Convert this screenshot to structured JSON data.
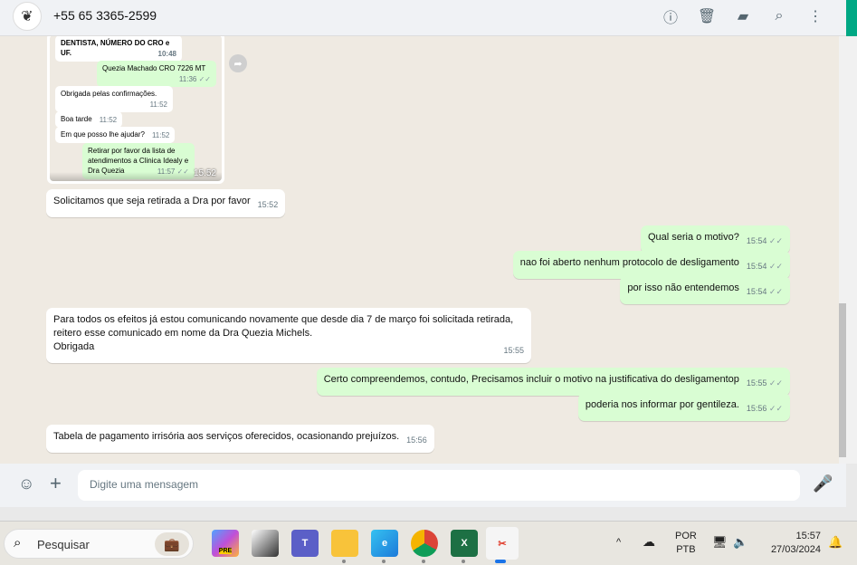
{
  "header": {
    "phone": "+55 65 3365-2599",
    "icons": [
      "info-icon",
      "trash-icon",
      "label-icon",
      "search-icon",
      "menu-icon"
    ]
  },
  "image": {
    "time": "15:52",
    "messages": [
      {
        "text": "DENTISTA, NÚMERO DO CRO e UF.",
        "time": "10:48",
        "dir": "in"
      },
      {
        "text": "Quezia Machado CRO 7226 MT",
        "time": "11:36",
        "dir": "out"
      },
      {
        "text": "Obrigada pelas confirmações.",
        "time": "11:52",
        "dir": "in"
      },
      {
        "text": "Boa tarde",
        "time": "11:52",
        "dir": "in"
      },
      {
        "text": "Em que posso lhe ajudar?",
        "time": "11:52",
        "dir": "in"
      },
      {
        "text": "Retirar por favor da lista de atendimentos a Clinica Idealy e Dra Quezia",
        "time": "11:57",
        "dir": "out"
      }
    ]
  },
  "messages": [
    {
      "text": "Solicitamos que seja retirada a Dra por favor",
      "time": "15:52"
    },
    {
      "text": "Qual seria o motivo?",
      "time": "15:54"
    },
    {
      "text": "nao foi aberto nenhum protocolo de desligamento",
      "time": "15:54"
    },
    {
      "text": "por isso não entendemos",
      "time": "15:54"
    },
    {
      "line1": "Para todos os efeitos já estou comunicando novamente que desde dia 7 de março foi solicitada retirada,",
      "line2": "reitero esse comunicado em nome da Dra Quezia Michels.",
      "line3": "Obrigada",
      "time": "15:55"
    },
    {
      "text": "Certo compreendemos, contudo, Precisamos incluir o motivo na justificativa do desligamentop",
      "time": "15:55"
    },
    {
      "text": "poderia nos informar por gentileza.",
      "time": "15:56"
    },
    {
      "text": "Tabela de pagamento irrisória aos serviços oferecidos, ocasionando prejuízos.",
      "time": "15:56"
    }
  ],
  "composer": {
    "placeholder": "Digite uma mensagem"
  },
  "taskbar": {
    "search": "Pesquisar",
    "copilot_badge": "PRE",
    "lang1": "POR",
    "lang2": "PTB",
    "time": "15:57",
    "date": "27/03/2024"
  }
}
